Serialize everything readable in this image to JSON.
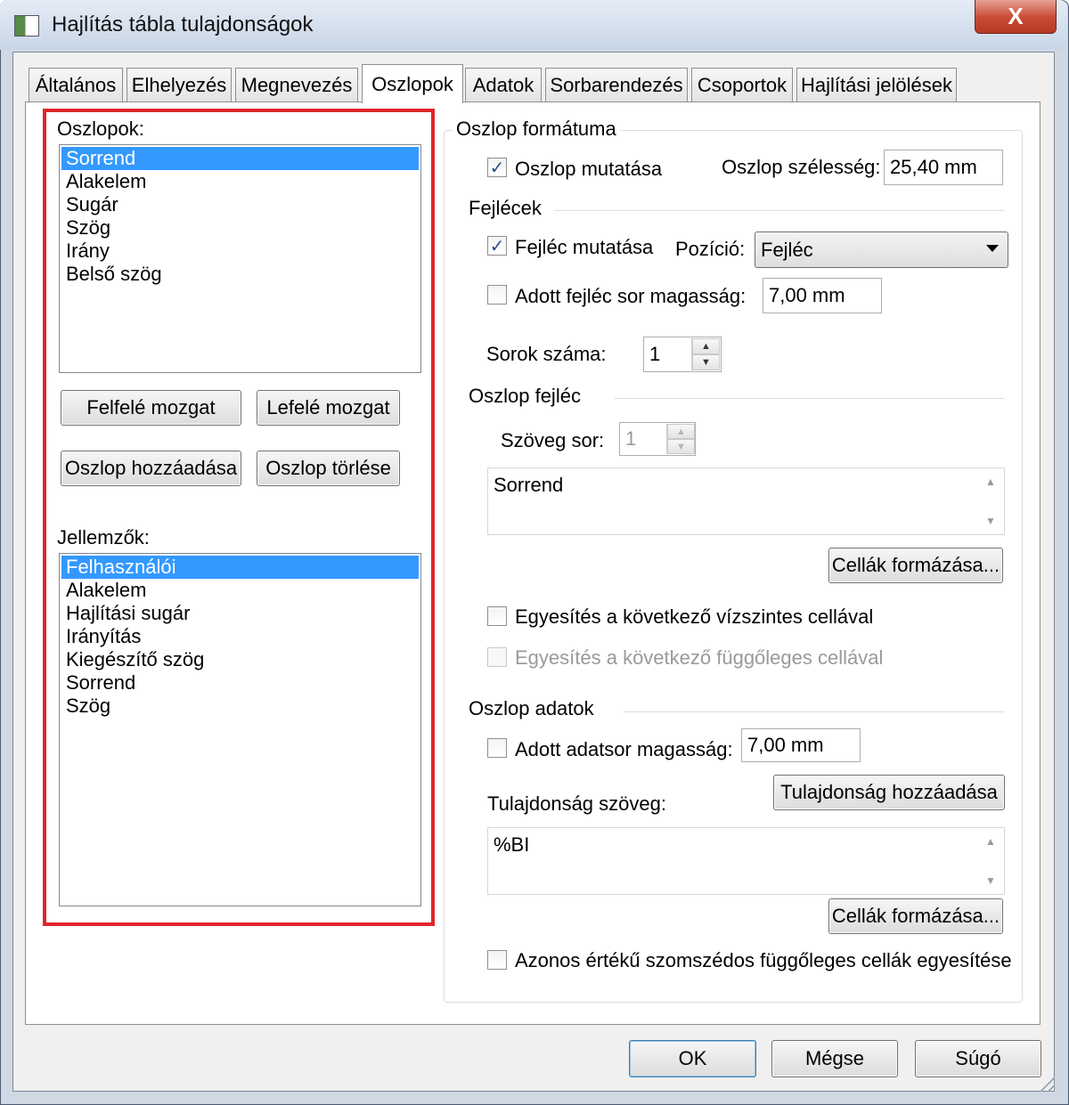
{
  "window": {
    "title": "Hajlítás tábla tulajdonságok",
    "close_label": "X"
  },
  "tabs": [
    {
      "label": "Általános"
    },
    {
      "label": "Elhelyezés"
    },
    {
      "label": "Megnevezés"
    },
    {
      "label": "Oszlopok"
    },
    {
      "label": "Adatok"
    },
    {
      "label": "Sorbarendezés"
    },
    {
      "label": "Csoportok"
    },
    {
      "label": "Hajlítási jelölések"
    }
  ],
  "active_tab": "Oszlopok",
  "left": {
    "columns_label": "Oszlopok:",
    "columns": [
      "Sorrend",
      "Alakelem",
      "Sugár",
      "Szög",
      "Irány",
      "Belső szög"
    ],
    "selected_column": "Sorrend",
    "move_up": "Felfelé mozgat",
    "move_down": "Lefelé mozgat",
    "add_column": "Oszlop hozzáadása",
    "delete_column": "Oszlop törlése",
    "properties_label": "Jellemzők:",
    "properties": [
      "Felhasználói",
      "Alakelem",
      "Hajlítási sugár",
      "Irányítás",
      "Kiegészítő szög",
      "Sorrend",
      "Szög"
    ],
    "selected_property": "Felhasználói"
  },
  "format": {
    "group_title": "Oszlop formátuma",
    "show_column": {
      "label": "Oszlop mutatása",
      "checked": true
    },
    "width_label": "Oszlop szélesség:",
    "width_value": "25,40 mm",
    "headers_title": "Fejlécek",
    "show_header": {
      "label": "Fejléc mutatása",
      "checked": true
    },
    "position_label": "Pozíció:",
    "position_value": "Fejléc",
    "header_row_height": {
      "label": "Adott fejléc sor magasság:",
      "checked": false
    },
    "header_row_height_value": "7,00 mm",
    "rows_count_label": "Sorok száma:",
    "rows_count_value": "1",
    "column_header_title": "Oszlop fejléc",
    "text_row_label": "Szöveg sor:",
    "text_row_value": "1",
    "header_text": "Sorrend",
    "format_cells_1": "Cellák formázása...",
    "merge_horizontal": {
      "label": "Egyesítés a következő vízszintes cellával",
      "checked": false
    },
    "merge_vertical": {
      "label": "Egyesítés a következő függőleges cellával",
      "checked": false,
      "disabled": true
    },
    "column_data_title": "Oszlop adatok",
    "data_row_height": {
      "label": "Adott adatsor magasság:",
      "checked": false
    },
    "data_row_height_value": "7,00 mm",
    "property_text_label": "Tulajdonság szöveg:",
    "add_property": "Tulajdonság hozzáadása",
    "property_text": "%BI",
    "format_cells_2": "Cellák formázása...",
    "merge_same_vertical": {
      "label": "Azonos értékű szomszédos függőleges cellák egyesítése",
      "checked": false
    }
  },
  "footer": {
    "ok": "OK",
    "cancel": "Mégse",
    "help": "Súgó"
  },
  "colors": {
    "selection": "#3399ff",
    "highlight_border": "#e0262b"
  }
}
